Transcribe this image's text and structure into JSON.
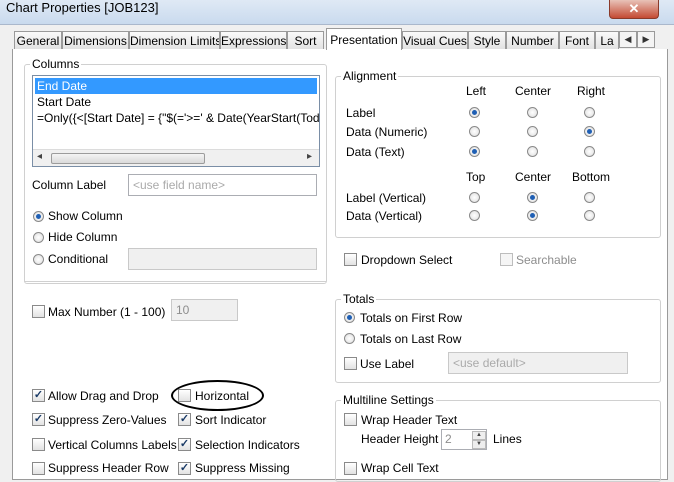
{
  "window": {
    "title": "Chart Properties [JOB123]",
    "close_glyph": "✕"
  },
  "tabs": [
    {
      "label": "General"
    },
    {
      "label": "Dimensions"
    },
    {
      "label": "Dimension Limits"
    },
    {
      "label": "Expressions"
    },
    {
      "label": "Sort"
    },
    {
      "label": "Presentation",
      "active": true
    },
    {
      "label": "Visual Cues"
    },
    {
      "label": "Style"
    },
    {
      "label": "Number"
    },
    {
      "label": "Font"
    },
    {
      "label": "La"
    }
  ],
  "tab_scroll": {
    "left": "◀",
    "right": "▶"
  },
  "columns": {
    "title": "Columns",
    "items": [
      "End Date",
      "Start Date",
      "=Only({<[Start Date] = {\"$(='>=' & Date(YearStart(Today()), '"
    ],
    "selected_index": 0,
    "scroll_left": "◂",
    "scroll_right": "▸",
    "column_label": "Column Label",
    "column_label_placeholder": "<use field name>",
    "show_column": "Show Column",
    "hide_column": "Hide Column",
    "conditional": "Conditional"
  },
  "alignment": {
    "title": "Alignment",
    "h_headers": [
      "Left",
      "Center",
      "Right"
    ],
    "h_rows": [
      {
        "label": "Label",
        "selected": 0
      },
      {
        "label": "Data (Numeric)",
        "selected": 2
      },
      {
        "label": "Data (Text)",
        "selected": 0
      }
    ],
    "v_headers": [
      "Top",
      "Center",
      "Bottom"
    ],
    "v_rows": [
      {
        "label": "Label (Vertical)",
        "selected": 1
      },
      {
        "label": "Data (Vertical)",
        "selected": 1
      }
    ]
  },
  "dropdown_select": {
    "label": "Dropdown Select",
    "checked": false
  },
  "searchable": {
    "label": "Searchable",
    "checked": false
  },
  "max_number": {
    "label": "Max Number (1 - 100)",
    "value": "10"
  },
  "totals": {
    "title": "Totals",
    "first_row": "Totals on First Row",
    "last_row": "Totals on Last Row",
    "use_label": "Use Label",
    "use_label_placeholder": "<use default>"
  },
  "options": [
    {
      "label": "Allow Drag and Drop",
      "checked": true
    },
    {
      "label": "Horizontal",
      "checked": false
    },
    {
      "label": "Suppress Zero-Values",
      "checked": true
    },
    {
      "label": "Sort Indicator",
      "checked": true
    },
    {
      "label": "Vertical Columns Labels",
      "checked": false
    },
    {
      "label": "Selection Indicators",
      "checked": true
    },
    {
      "label": "Suppress Header Row",
      "checked": false
    },
    {
      "label": "Suppress Missing",
      "checked": true
    }
  ],
  "multiline": {
    "title": "Multiline Settings",
    "wrap_header": "Wrap Header Text",
    "header_height": "Header Height",
    "header_height_value": "2",
    "lines": "Lines",
    "wrap_cell": "Wrap Cell Text"
  }
}
